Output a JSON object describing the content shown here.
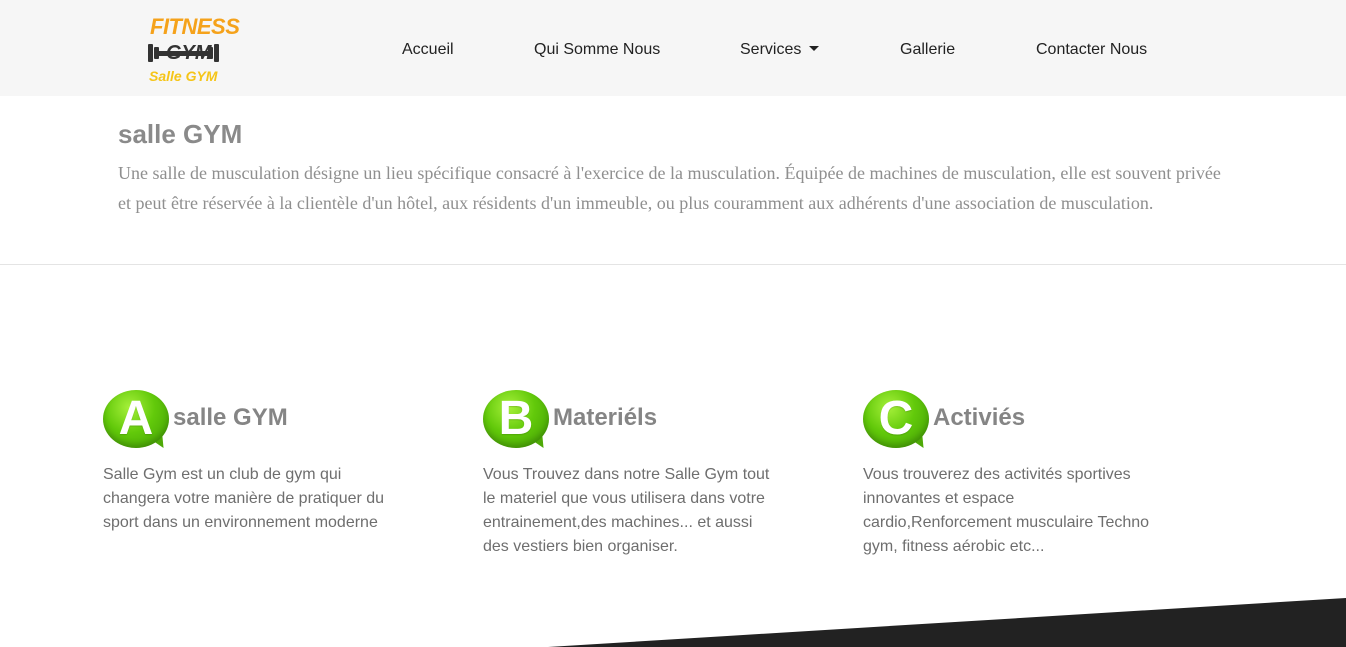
{
  "logo": {
    "line1": "FITNESS",
    "line2": "GYM",
    "line3": "Salle GYM"
  },
  "nav": {
    "items": [
      {
        "label": "Accueil"
      },
      {
        "label": "Qui Somme Nous"
      },
      {
        "label": "Services",
        "has_dropdown": true
      },
      {
        "label": "Gallerie"
      },
      {
        "label": "Contacter Nous"
      }
    ]
  },
  "intro": {
    "title": "salle GYM",
    "text": "Une salle de musculation désigne un lieu spécifique consacré à l'exercice de la musculation. Équipée de machines de musculation, elle est souvent privée et peut être réservée à la clientèle d'un hôtel, aux résidents d'un immeuble, ou plus couramment aux adhérents d'une association de musculation."
  },
  "features": [
    {
      "letter": "A",
      "title": "salle GYM",
      "text": "Salle Gym est un club de gym qui changera votre manière de pratiquer du sport dans un environnement moderne",
      "icon": "letter-a-bubble-icon"
    },
    {
      "letter": "B",
      "title": "Materiéls",
      "text": "Vous Trouvez dans notre Salle Gym tout le materiel que vous utilisera dans votre entrainement,des machines... et aussi des vestiers bien organiser.",
      "icon": "letter-b-bubble-icon"
    },
    {
      "letter": "C",
      "title": "Activiés",
      "text": "Vous trouverez des activités sportives innovantes et espace cardio,Renforcement musculaire Techno gym, fitness aérobic etc...",
      "icon": "letter-c-bubble-icon"
    }
  ],
  "colors": {
    "navbar_bg": "#f6f6f6",
    "logo_orange": "#f5a21b",
    "logo_yellow": "#f5c518",
    "badge_green": "#62c90a",
    "footer_dark": "#222222"
  }
}
